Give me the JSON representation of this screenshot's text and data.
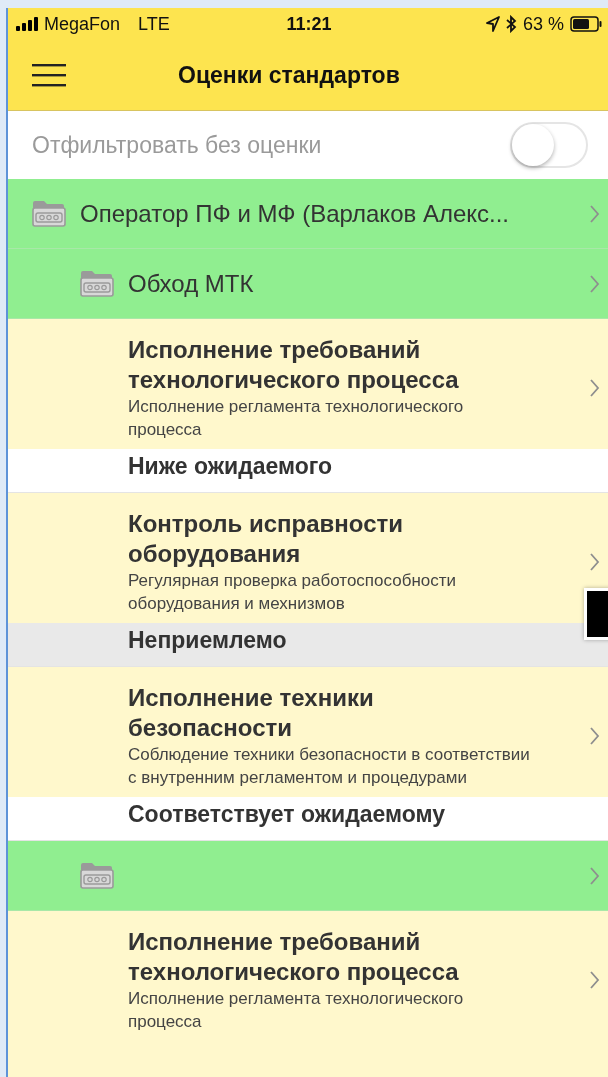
{
  "status_bar": {
    "carrier": "MegaFon",
    "network": "LTE",
    "time": "11:21",
    "battery": "63 %"
  },
  "nav_bar": {
    "title": "Оценки стандартов"
  },
  "filter": {
    "label": "Отфильтровать без оценки",
    "on": false
  },
  "list": [
    {
      "kind": "group",
      "title": "Оператор ПФ и МФ (Варлаков Алекс...",
      "children": [
        {
          "kind": "group",
          "title": "Обход МТК",
          "children": [
            {
              "kind": "standard",
              "title": "Исполнение требований технологического процесса",
              "description": "Исполнение регламента технологического процесса",
              "rating": "Ниже ожидаемого",
              "selected": false
            },
            {
              "kind": "standard",
              "title": "Контроль исправности оборудования",
              "description": "Регулярная проверка работоспособности оборудования и мехнизмов",
              "rating": "Неприемлемо",
              "selected": true
            },
            {
              "kind": "standard",
              "title": "Исполнение техники безопасности",
              "description": "Соблюдение техники безопасности в соответствии с внутренним регламентом и процедурами",
              "rating": "Соответствует ожидаемому",
              "selected": false
            }
          ]
        },
        {
          "kind": "group",
          "children": [
            {
              "kind": "standard",
              "title": "Исполнение требований технологического процесса",
              "description": "Исполнение регламента технологического процесса"
            }
          ]
        }
      ]
    }
  ]
}
